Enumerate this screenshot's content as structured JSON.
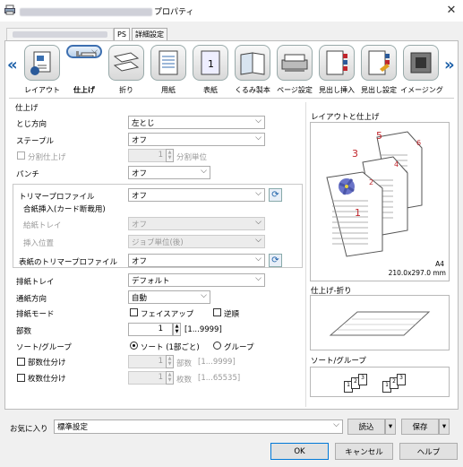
{
  "window": {
    "title_suffix": "プロパティ",
    "close": "✕"
  },
  "tabs": [
    {
      "label": "PS"
    },
    {
      "label": "詳細設定"
    }
  ],
  "nav": {
    "left": "«",
    "right": "»"
  },
  "categories": [
    {
      "label": "レイアウト",
      "icon": "layout-icon"
    },
    {
      "label": "仕上げ",
      "icon": "finishing-icon",
      "selected": true
    },
    {
      "label": "折り",
      "icon": "fold-icon"
    },
    {
      "label": "用紙",
      "icon": "paper-icon"
    },
    {
      "label": "表紙",
      "icon": "cover-icon"
    },
    {
      "label": "くるみ製本",
      "icon": "perfect-binding-icon"
    },
    {
      "label": "ページ設定",
      "icon": "page-setup-icon"
    },
    {
      "label": "見出し挿入",
      "icon": "tab-insert-icon"
    },
    {
      "label": "見出し設定",
      "icon": "tab-setting-icon"
    },
    {
      "label": "イメージング",
      "icon": "imaging-icon"
    }
  ],
  "finishing": {
    "section_title": "仕上げ",
    "binding_direction": {
      "label": "とじ方向",
      "value": "左とじ"
    },
    "staple": {
      "label": "ステープル",
      "value": "オフ"
    },
    "split": {
      "label": "分割仕上げ",
      "value": "1",
      "unit": "分割単位"
    },
    "punch": {
      "label": "パンチ",
      "value": "オフ"
    },
    "trimmer_profile": {
      "label": "トリマープロファイル",
      "value": "オフ"
    },
    "insert_sheet": {
      "label": "合紙挿入(カード断裁用)"
    },
    "feed_tray": {
      "label": "給紙トレイ",
      "value": "オフ"
    },
    "insert_position": {
      "label": "挿入位置",
      "value": "ジョブ単位(後)"
    },
    "cover_trimmer_profile": {
      "label": "表紙のトリマープロファイル",
      "value": "オフ"
    },
    "output_tray": {
      "label": "排紙トレイ",
      "value": "デフォルト"
    },
    "feed_direction": {
      "label": "通紙方向",
      "value": "自動"
    },
    "output_mode": {
      "label": "排紙モード",
      "face_up": "フェイスアップ",
      "reverse": "逆順"
    },
    "copies": {
      "label": "部数",
      "value": "1",
      "range": "[1...9999]"
    },
    "sort": {
      "label": "ソート/グループ",
      "sort_option": "ソート (1部ごと)",
      "group_option": "グループ"
    },
    "copy_split": {
      "label": "部数仕分け",
      "value": "1",
      "unit": "部数",
      "range": "[1...9999]"
    },
    "sheet_split": {
      "label": "枚数仕分け",
      "value": "1",
      "unit": "枚数",
      "range": "[1...65535]"
    }
  },
  "preview": {
    "layout_title": "レイアウトと仕上げ",
    "page_numbers": [
      "1",
      "2",
      "3",
      "4",
      "5",
      "6"
    ],
    "paper": "A4",
    "paper_size": "210.0x297.0 mm",
    "fold_title": "仕上げ-折り",
    "sort_title": "ソート/グループ",
    "sort_stacks": [
      "1",
      "2",
      "3",
      "1",
      "2",
      "3"
    ]
  },
  "favorites": {
    "label": "お気に入り",
    "value": "標準設定",
    "load": "読込",
    "save": "保存"
  },
  "footer": {
    "ok": "OK",
    "cancel": "キャンセル",
    "help": "ヘルプ"
  }
}
